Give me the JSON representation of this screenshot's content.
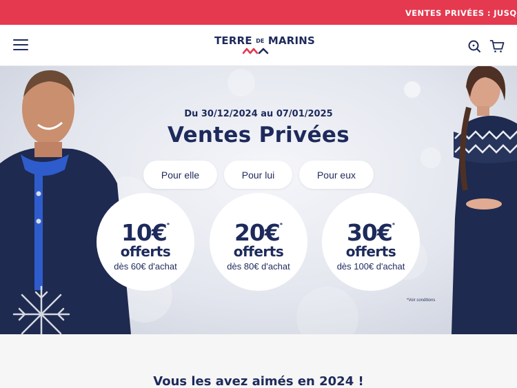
{
  "announcement": {
    "text": "VENTES PRIVÉES : JUSQU'À"
  },
  "header": {
    "logo_main": "TERRE",
    "logo_de": "DE",
    "logo_end": "MARINS",
    "menu_icon": "hamburger-menu-icon",
    "search_icon": "search-icon",
    "cart_icon": "shopping-cart-icon"
  },
  "hero": {
    "dates": "Du 30/12/2024 au 07/01/2025",
    "title": "Ventes Privées",
    "pills": [
      {
        "label": "Pour elle"
      },
      {
        "label": "Pour lui"
      },
      {
        "label": "Pour eux"
      }
    ],
    "offers": [
      {
        "amount": "10€",
        "label": "offerts",
        "condition": "dès 60€ d'achat"
      },
      {
        "amount": "20€",
        "label": "offerts",
        "condition": "dès 80€ d'achat"
      },
      {
        "amount": "30€",
        "label": "offerts",
        "condition": "dès 100€ d'achat"
      }
    ],
    "offer_asterisk": "*",
    "conditions_note": "*Voir conditions"
  },
  "section": {
    "title": "Vous les avez aimés en 2024 !"
  },
  "colors": {
    "brand_navy": "#1d2a5b",
    "announce_red": "#e4394f",
    "logo_red": "#e4394f"
  }
}
